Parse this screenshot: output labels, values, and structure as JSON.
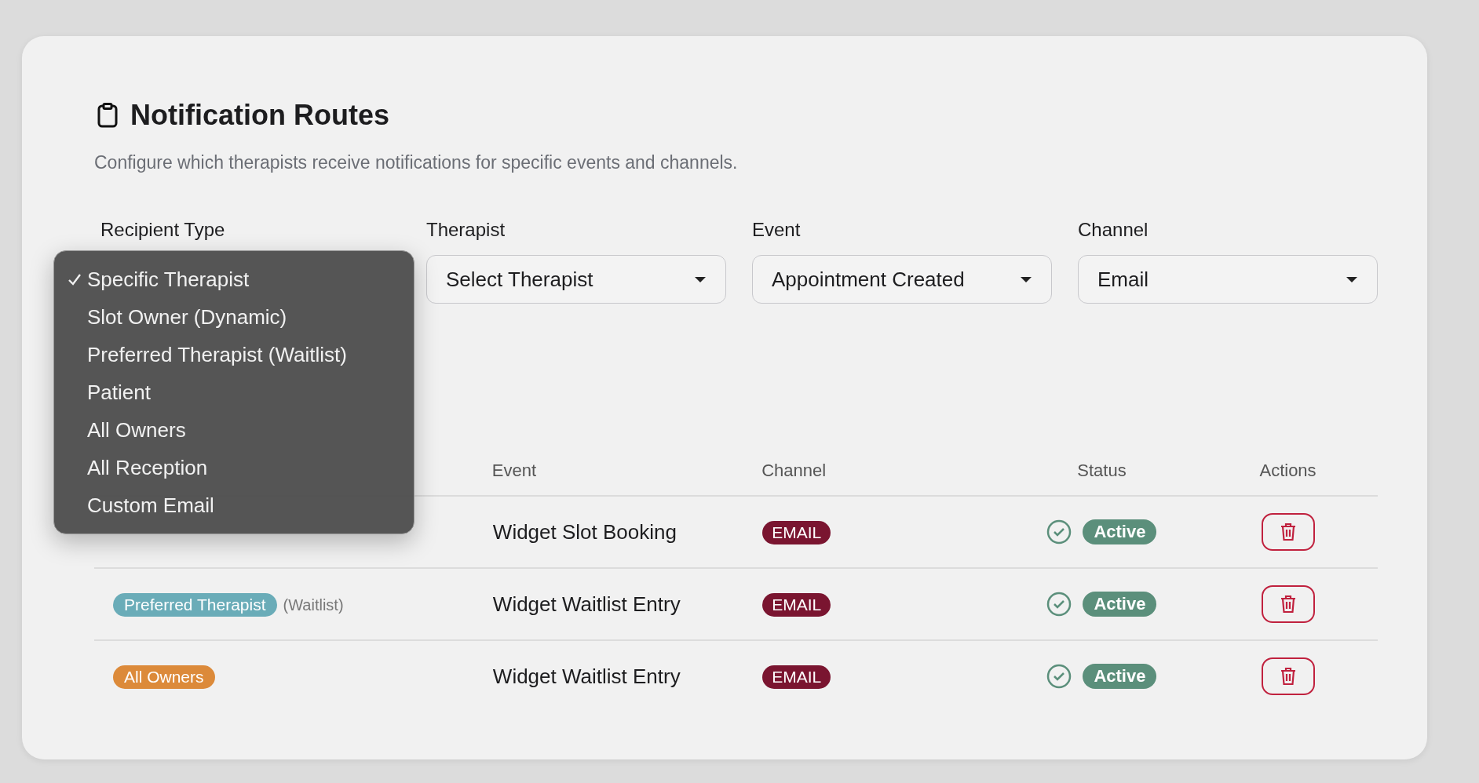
{
  "title": "Notification Routes",
  "subtitle": "Configure which therapists receive notifications for specific events and channels.",
  "filters": [
    {
      "label": "Recipient Type"
    },
    {
      "label": "Therapist",
      "value": "Select Therapist"
    },
    {
      "label": "Event",
      "value": "Appointment Created"
    },
    {
      "label": "Channel",
      "value": "Email"
    }
  ],
  "recipient_menu": {
    "options": [
      {
        "label": "Specific Therapist",
        "selected": true
      },
      {
        "label": "Slot Owner (Dynamic)",
        "selected": false
      },
      {
        "label": "Preferred Therapist (Waitlist)",
        "selected": false
      },
      {
        "label": "Patient",
        "selected": false
      },
      {
        "label": "All Owners",
        "selected": false
      },
      {
        "label": "All Reception",
        "selected": false
      },
      {
        "label": "Custom Email",
        "selected": false
      }
    ]
  },
  "table": {
    "columns": [
      "Event",
      "Channel",
      "Status",
      "Actions"
    ],
    "rows": [
      {
        "event": "Widget Slot Booking",
        "channel": "EMAIL",
        "status": "Active"
      },
      {
        "recipient": {
          "label": "Preferred Therapist",
          "color": "#6aacb8",
          "note": "(Waitlist)"
        },
        "event": "Widget Waitlist Entry",
        "channel": "EMAIL",
        "status": "Active"
      },
      {
        "recipient": {
          "label": "All Owners",
          "color": "#dc8a3a"
        },
        "event": "Widget Waitlist Entry",
        "channel": "EMAIL",
        "status": "Active"
      }
    ]
  }
}
